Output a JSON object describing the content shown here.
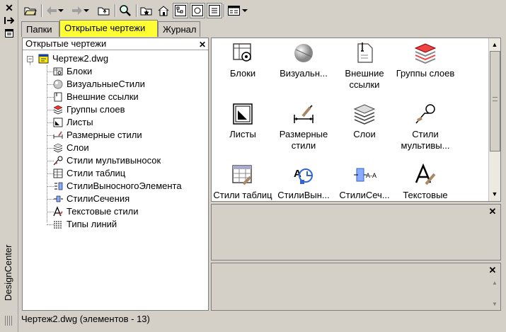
{
  "side": {
    "title": "DesignCenter"
  },
  "toolbar": {
    "buttons": [
      "load-icon",
      "back-icon",
      "forward-icon",
      "up-icon",
      "search-icon",
      "favorites-icon",
      "home-icon",
      "tree-view-icon",
      "preview-icon",
      "description-icon",
      "views-icon"
    ]
  },
  "tabs": [
    {
      "label": "Папки"
    },
    {
      "label": "Открытые чертежи"
    },
    {
      "label": "Журнал"
    }
  ],
  "tree": {
    "header": "Открытые чертежи",
    "root": "Чертеж2.dwg",
    "items": [
      "Блоки",
      "ВизуальныеСтили",
      "Внешние ссылки",
      "Группы слоев",
      "Листы",
      "Размерные стили",
      "Слои",
      "Стили мультивыносок",
      "Стили таблиц",
      "СтилиВыносногоЭлемента",
      "СтилиСечения",
      "Текстовые стили",
      "Типы линий"
    ]
  },
  "content": {
    "items": [
      {
        "label": "Блоки",
        "icon": "blocks-icon"
      },
      {
        "label": "Визуальн...",
        "icon": "visual-styles-icon"
      },
      {
        "label": "Внешние ссылки",
        "icon": "xref-icon"
      },
      {
        "label": "Группы слоев",
        "icon": "layer-groups-icon"
      },
      {
        "label": "Листы",
        "icon": "layouts-icon"
      },
      {
        "label": "Размерные стили",
        "icon": "dimstyles-icon"
      },
      {
        "label": "Слои",
        "icon": "layers-icon"
      },
      {
        "label": "Стили мультивы...",
        "icon": "mleader-styles-icon"
      },
      {
        "label": "Стили таблиц",
        "icon": "table-styles-icon"
      },
      {
        "label": "СтилиВын...",
        "icon": "detail-view-styles-icon"
      },
      {
        "label": "СтилиСеч...",
        "icon": "section-view-styles-icon"
      },
      {
        "label": "Текстовые стили",
        "icon": "text-styles-icon"
      }
    ]
  },
  "status": "Чертеж2.dwg (элементов  - 13)"
}
